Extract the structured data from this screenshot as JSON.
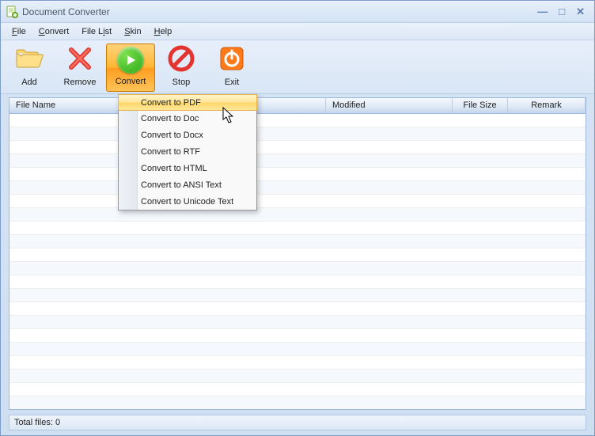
{
  "window": {
    "title": "Document Converter"
  },
  "menubar": {
    "items": [
      {
        "label": "File",
        "accel": "F"
      },
      {
        "label": "Convert",
        "accel": "C"
      },
      {
        "label": "File List",
        "accel": ""
      },
      {
        "label": "Skin",
        "accel": "S"
      },
      {
        "label": "Help",
        "accel": "H"
      }
    ]
  },
  "toolbar": {
    "add": "Add",
    "remove": "Remove",
    "convert": "Convert",
    "stop": "Stop",
    "exit": "Exit"
  },
  "columns": {
    "filename": "File Name",
    "modified": "Modified",
    "filesize": "File Size",
    "remark": "Remark"
  },
  "dropdown": {
    "items": [
      "Convert to PDF",
      "Convert to Doc",
      "Convert to Docx",
      "Convert to RTF",
      "Convert to HTML",
      "Convert to ANSI Text",
      "Convert to Unicode Text"
    ],
    "highlighted_index": 0
  },
  "status": {
    "text": "Total files: 0"
  }
}
